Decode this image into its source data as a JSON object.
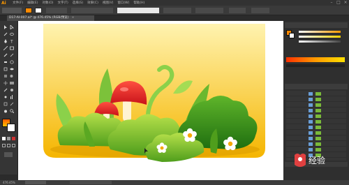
{
  "app": {
    "logo": "Ai"
  },
  "menu": [
    "文件(F)",
    "编辑(E)",
    "对象(O)",
    "文字(T)",
    "选择(S)",
    "效果(C)",
    "视图(V)",
    "窗口(W)",
    "帮助(H)"
  ],
  "document": {
    "tab_title": "D17-AI-007.ai* @ 476.45% (RGB/预览)"
  },
  "status": {
    "zoom": "476.45%"
  },
  "watermark": {
    "text": "经验"
  },
  "colors": {
    "accent": "#ff9a00",
    "sky_top": "#fff3b0",
    "sky_bottom": "#f5b500"
  }
}
